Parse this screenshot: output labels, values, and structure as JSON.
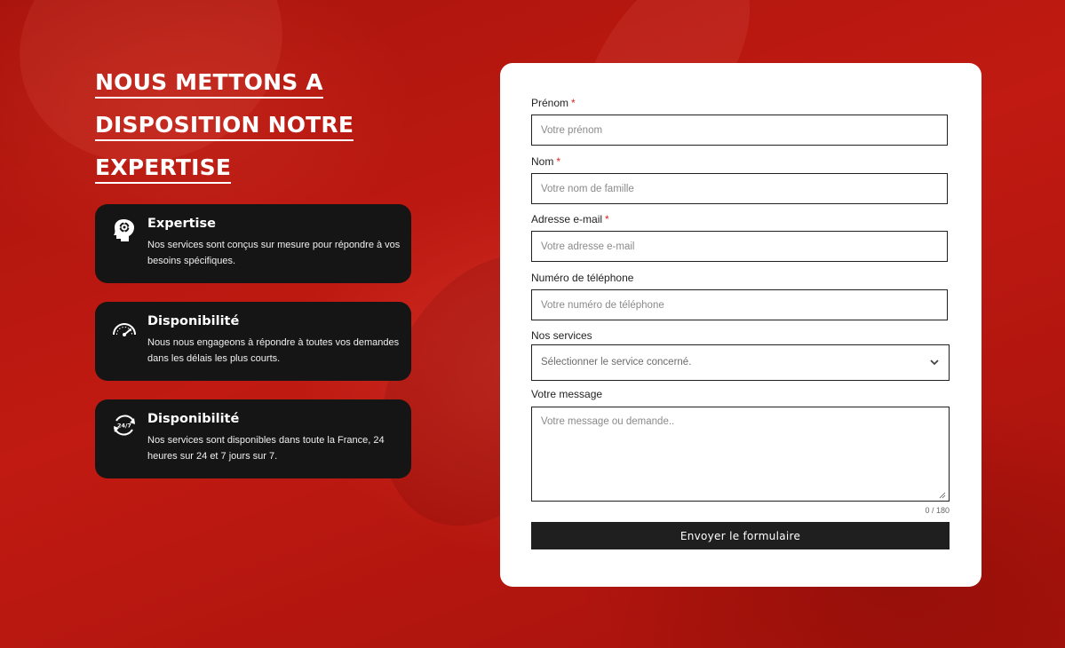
{
  "hero": {
    "headline_lines": [
      "NOUS METTONS A",
      "DISPOSITION NOTRE",
      "EXPERTISE"
    ]
  },
  "features": [
    {
      "icon": "head-gear-icon",
      "title": "Expertise",
      "desc": "Nos services sont conçus sur mesure pour répondre à vos besoins spécifiques."
    },
    {
      "icon": "speedometer-icon",
      "title": "Disponibilité",
      "desc": "Nous nous engageons à répondre à toutes vos demandes dans les délais les plus courts."
    },
    {
      "icon": "clock-24-7-icon",
      "icon_text": "24/7",
      "title": "Disponibilité",
      "desc": "Nos services sont disponibles dans toute la France, 24 heures sur 24 et 7 jours sur 7."
    }
  ],
  "form": {
    "required_mark": "*",
    "firstname": {
      "label": "Prénom",
      "placeholder": "Votre prénom",
      "value": ""
    },
    "lastname": {
      "label": "Nom",
      "placeholder": "Votre nom de famille",
      "value": ""
    },
    "email": {
      "label": "Adresse e-mail",
      "placeholder": "Votre adresse e-mail",
      "value": ""
    },
    "phone": {
      "label": "Numéro de téléphone",
      "placeholder": "Votre numéro de téléphone",
      "value": ""
    },
    "service": {
      "label": "Nos services",
      "selected": "Sélectionner le service concerné."
    },
    "message": {
      "label": "Votre message",
      "placeholder": "Votre message ou demande..",
      "counter": "0 / 180"
    },
    "submit_label": "Envoyer le formulaire"
  },
  "colors": {
    "background_red": "#b5150f",
    "card_dark": "#151515",
    "button_dark": "#1f1f1f",
    "required_red": "#d9261c"
  }
}
